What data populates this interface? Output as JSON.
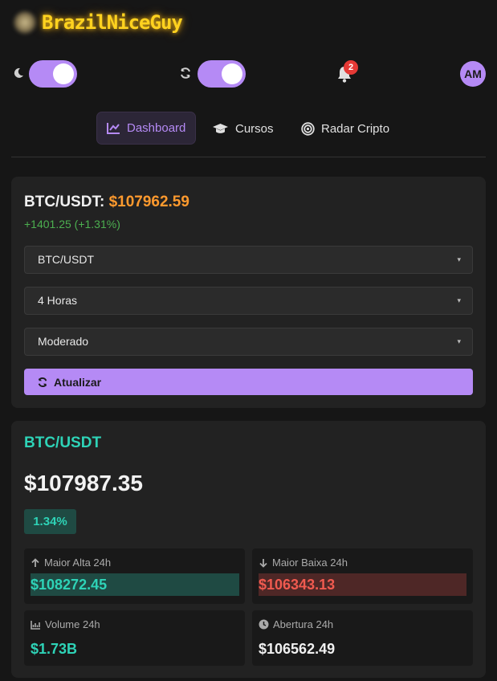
{
  "header": {
    "logo_text": "BrazilNiceGuy",
    "notifications_count": "2",
    "avatar_initials": "AM",
    "dark_mode_on": true,
    "auto_refresh_on": true
  },
  "nav": {
    "items": [
      {
        "label": "Dashboard",
        "icon": "chart-line-icon",
        "active": true
      },
      {
        "label": "Cursos",
        "icon": "graduation-cap-icon",
        "active": false
      },
      {
        "label": "Radar Cripto",
        "icon": "target-icon",
        "active": false
      }
    ]
  },
  "ticker": {
    "pair_label": "BTC/USDT:",
    "price": "$107962.59",
    "change": "+1401.25 (+1.31%)"
  },
  "filters": {
    "pair": "BTC/USDT",
    "timeframe": "4 Horas",
    "risk": "Moderado",
    "update_label": "Atualizar"
  },
  "summary": {
    "pair": "BTC/USDT",
    "price": "$107987.35",
    "change_pct": "1.34%",
    "stats": {
      "high": {
        "label": "Maior Alta 24h",
        "value": "$108272.45"
      },
      "low": {
        "label": "Maior Baixa 24h",
        "value": "$106343.13"
      },
      "volume": {
        "label": "Volume 24h",
        "value": "$1.73B"
      },
      "open": {
        "label": "Abertura 24h",
        "value": "$106562.49"
      }
    }
  },
  "colors": {
    "accent": "#b58af5",
    "teal": "#2ed3b7",
    "orange": "#ff9a2e",
    "red": "#f05a4f",
    "green": "#4caf50",
    "logo": "#ffd21f"
  }
}
